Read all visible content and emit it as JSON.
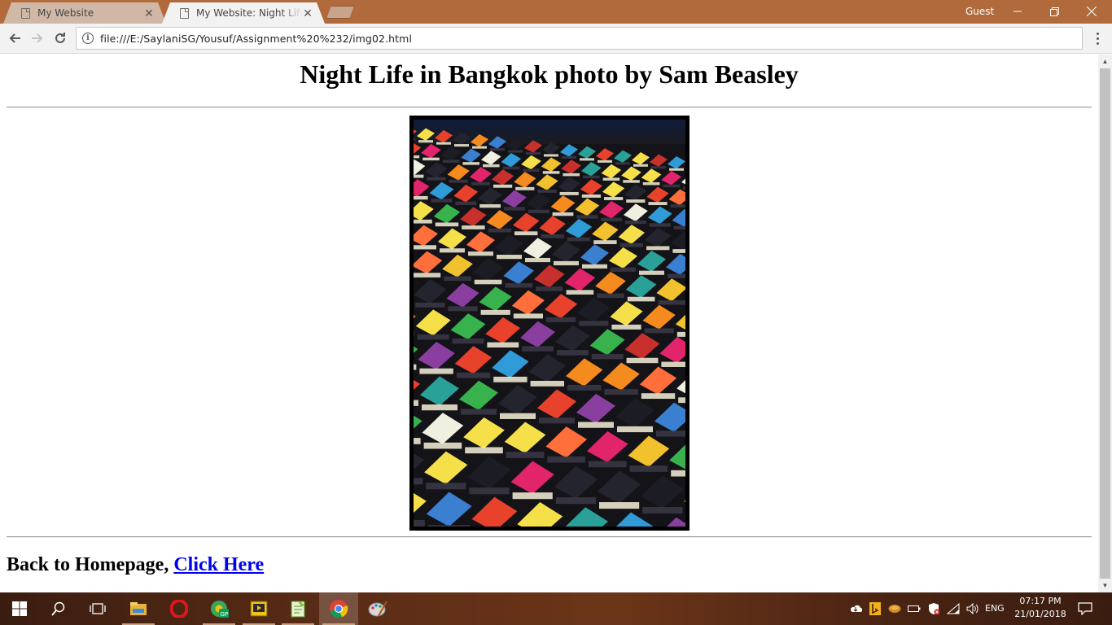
{
  "browser": {
    "tabs": [
      {
        "title": "My Website",
        "active": false
      },
      {
        "title": "My Website: Night Life in Bangkok photo by Sam Beasley",
        "active": true
      }
    ],
    "profile": "Guest",
    "address": "file:///E:/SaylaniSG/Yousuf/Assignment%20%232/img02.html",
    "icons": {
      "back": "arrow-left-icon",
      "forward": "arrow-right-icon",
      "reload": "reload-icon",
      "info": "info-icon",
      "menu": "vertical-dots-icon"
    }
  },
  "page": {
    "heading": "Night Life in Bangkok photo by Sam Beasley",
    "photo_alt": "Aerial view of colorful night market tents",
    "back_text": "Back to Homepage, ",
    "back_link": "Click Here"
  },
  "taskbar": {
    "apps": [
      "windows-start-icon",
      "search-icon",
      "task-view-icon",
      "file-explorer-icon",
      "opera-icon",
      "chrome-gp-icon",
      "media-player-icon",
      "notepad-plus-plus-icon",
      "chrome-icon",
      "paint-icon"
    ],
    "language": "ENG",
    "time": "07:17 PM",
    "date": "21/01/2018"
  },
  "colors": {
    "titlebar": "#b06a3b",
    "link": "#0000ee"
  }
}
